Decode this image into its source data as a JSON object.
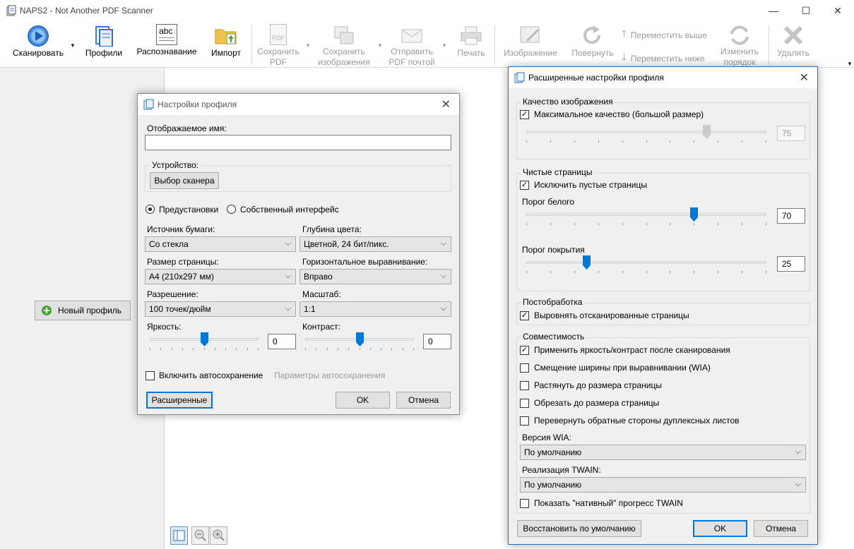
{
  "window": {
    "title": "NAPS2 - Not Another PDF Scanner",
    "minimize": "—",
    "maximize": "☐",
    "close": "✕"
  },
  "toolbar": {
    "scan": "Сканировать",
    "profiles": "Профили",
    "ocr": "Распознавание",
    "import": "Импорт",
    "save_pdf_1": "Сохранить",
    "save_pdf_2": "PDF",
    "save_images_1": "Сохранить",
    "save_images_2": "изображения",
    "email_pdf_1": "Отправить",
    "email_pdf_2": "PDF почтой",
    "print": "Печать",
    "image": "Изображение",
    "rotate": "Повернуть",
    "move_up": "Переместить выше",
    "move_down": "Переместить ниже",
    "reorder_1": "Изменить",
    "reorder_2": "порядок",
    "delete": "Удалить",
    "ocr_icon_text": "abc",
    "pdf_icon_text": "PDF"
  },
  "left_panel": {
    "new_profile": "Новый профиль"
  },
  "profile_dialog": {
    "title": "Настройки профиля",
    "display_name_label": "Отображаемое имя:",
    "display_name_value": "",
    "device_label": "Устройство:",
    "choose_scanner": "Выбор сканера",
    "radio_presets": "Предустановки",
    "radio_native": "Собственный интерфейс",
    "paper_source_label": "Источник бумаги:",
    "paper_source_value": "Со стекла",
    "bit_depth_label": "Глубина цвета:",
    "bit_depth_value": "Цветной, 24 бит/пикс.",
    "page_size_label": "Размер страницы:",
    "page_size_value": "А4 (210x297 мм)",
    "h_align_label": "Горизонтальное выравнивание:",
    "h_align_value": "Вправо",
    "resolution_label": "Разрешение:",
    "resolution_value": "100 точек/дюйм",
    "scale_label": "Масштаб:",
    "scale_value": "1:1",
    "brightness_label": "Яркость:",
    "brightness_value": "0",
    "brightness_level": 0.5,
    "contrast_label": "Контраст:",
    "contrast_value": "0",
    "contrast_level": 0.5,
    "autosave_label": "Включить автосохранение",
    "autosave_params": "Параметры автосохранения",
    "advanced": "Расширенные",
    "ok": "OK",
    "cancel": "Отмена"
  },
  "advanced_dialog": {
    "title": "Расширенные настройки профиля",
    "image_quality_group": "Качество изображения",
    "max_quality_label": "Максимальное качество (большой размер)",
    "quality_value": "75",
    "quality_level": 0.75,
    "blank_pages_group": "Чистые страницы",
    "exclude_blank_label": "Исключить пустые страницы",
    "white_threshold_label": "Порог белого",
    "white_threshold_value": "70",
    "white_threshold_level": 0.7,
    "coverage_threshold_label": "Порог покрытия",
    "coverage_threshold_value": "25",
    "coverage_threshold_level": 0.25,
    "postprocessing_group": "Постобработка",
    "deskew_label": "Выровнять отсканированные страницы",
    "compat_group": "Совместимость",
    "brightness_after_label": "Применить яркость/контраст после сканирования",
    "wia_offset_label": "Смещение ширины при выравнивании (WIA)",
    "stretch_label": "Растянуть до размера страницы",
    "crop_label": "Обрезать до размера страницы",
    "flip_duplex_label": "Перевернуть обратные стороны дуплексных листов",
    "wia_version_label": "Версия WIA:",
    "wia_version_value": "По умолчанию",
    "twain_impl_label": "Реализация TWAIN:",
    "twain_impl_value": "По умолчанию",
    "twain_progress_label": "Показать \"нативный\" прогресс TWAIN",
    "restore_defaults": "Восстановить по умолчанию",
    "ok": "OK",
    "cancel": "Отмена"
  }
}
